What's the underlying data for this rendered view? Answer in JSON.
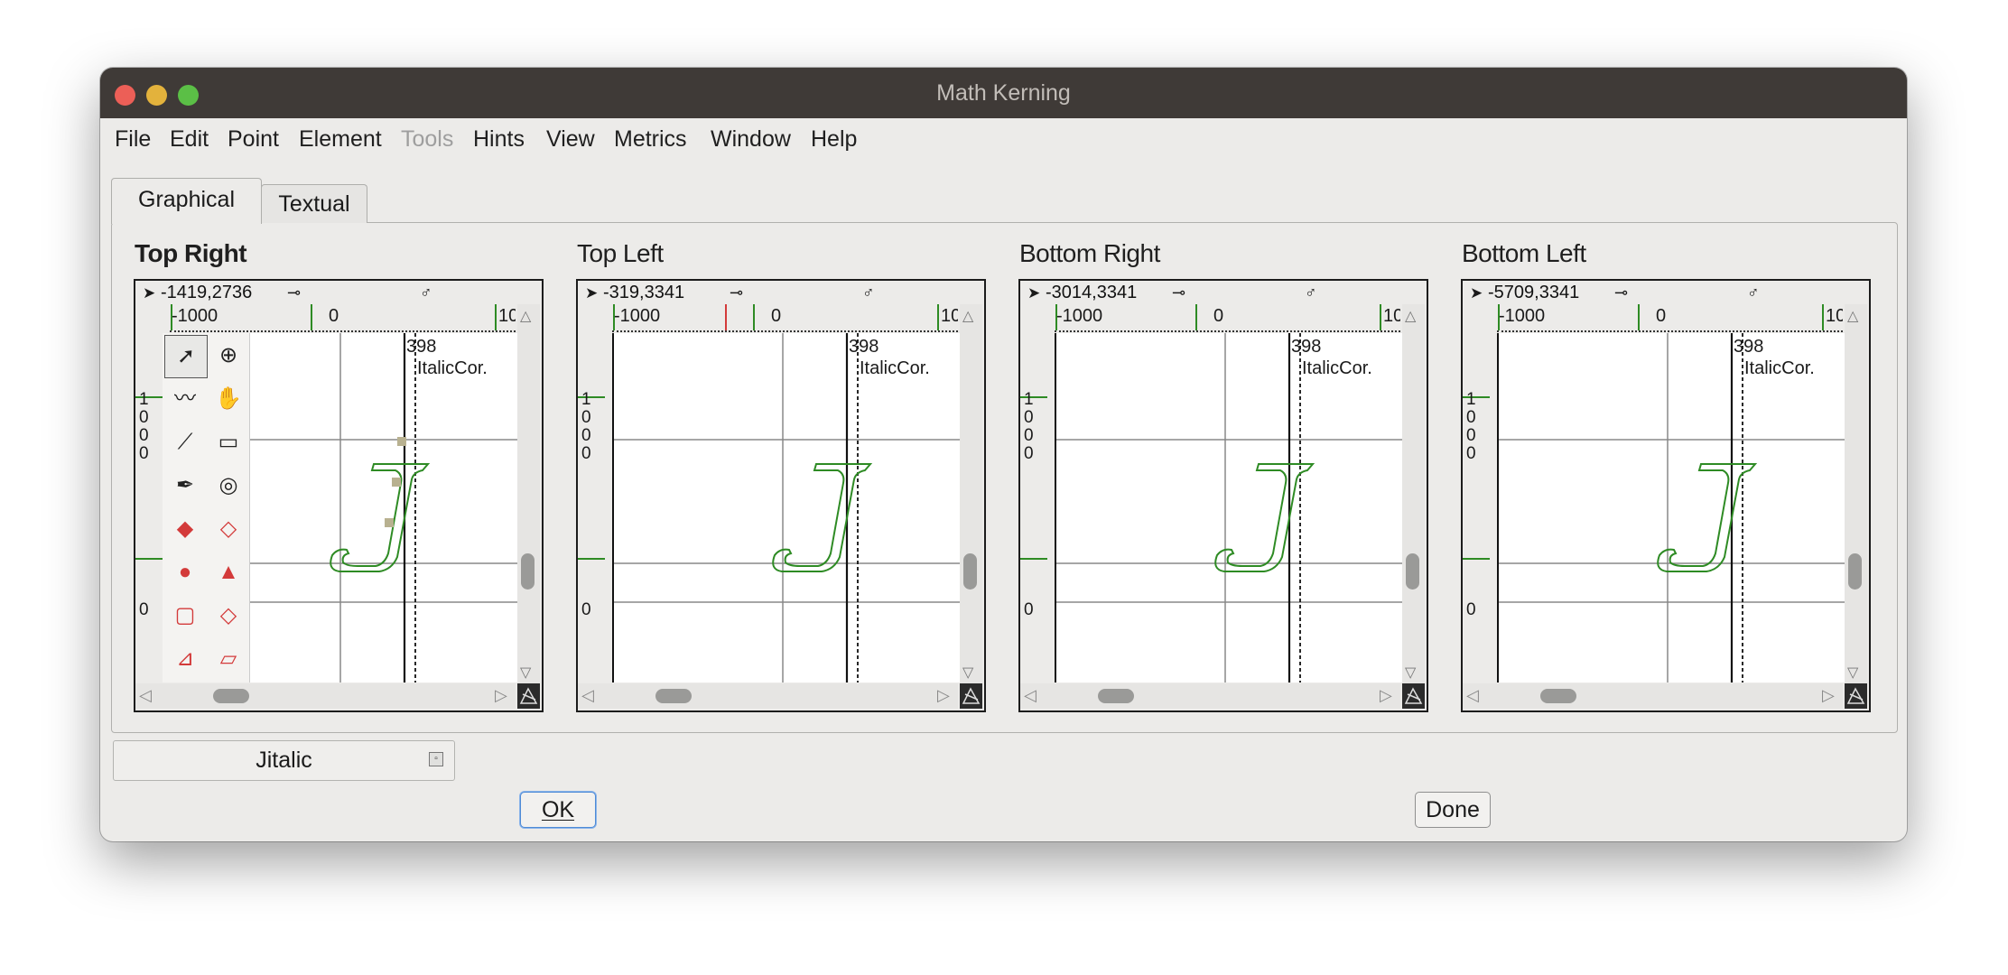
{
  "window": {
    "title": "Math Kerning",
    "traffic_lights": {
      "close": "#ec5f57",
      "minimize": "#e3b23c",
      "zoom": "#5bbf46"
    }
  },
  "menu": [
    {
      "label": "File",
      "enabled": true
    },
    {
      "label": "Edit",
      "enabled": true
    },
    {
      "label": "Point",
      "enabled": true
    },
    {
      "label": "Element",
      "enabled": true
    },
    {
      "label": "Tools",
      "enabled": false
    },
    {
      "label": "Hints",
      "enabled": true
    },
    {
      "label": "View",
      "enabled": true
    },
    {
      "label": "Metrics",
      "enabled": true
    },
    {
      "label": "Window",
      "enabled": true
    },
    {
      "label": "Help",
      "enabled": true
    }
  ],
  "tabs": [
    {
      "label": "Graphical",
      "active": true
    },
    {
      "label": "Textual",
      "active": false
    }
  ],
  "panels": [
    {
      "label": "Top Right",
      "active": true,
      "coords": "-1419,2736"
    },
    {
      "label": "Top Left",
      "active": false,
      "coords": "-319,3341"
    },
    {
      "label": "Bottom Right",
      "active": false,
      "coords": "-3014,3341"
    },
    {
      "label": "Bottom Left",
      "active": false,
      "coords": "-5709,3341"
    }
  ],
  "ruler": {
    "h_ticks": [
      "-1000",
      "0",
      "10"
    ],
    "v_ticks": [
      "1",
      "0",
      "0",
      "0",
      "0"
    ]
  },
  "glyph": {
    "char": "J",
    "advance_label": "398",
    "italic_label": "ItalicCor.",
    "color": "#2e8b24"
  },
  "glyph_dropdown": {
    "value": "Jitalic"
  },
  "buttons": {
    "ok": "OK",
    "done": "Done"
  },
  "colors": {
    "window_bg": "#ecebe9",
    "titlebar": "#3f3a37",
    "guide_green": "#2e8b24",
    "guide_red": "#d33a3a"
  },
  "tools": [
    "pointer-icon",
    "magnify-icon",
    "freehand-icon",
    "hand-icon",
    "knife-icon",
    "ruler-icon",
    "pen-icon",
    "spiro-icon",
    "curve-point-icon",
    "hv-curve-point-icon",
    "corner-point-icon",
    "tangent-point-icon",
    "rectangle-icon",
    "polygon-icon",
    "rotate-icon",
    "perspective-icon"
  ]
}
